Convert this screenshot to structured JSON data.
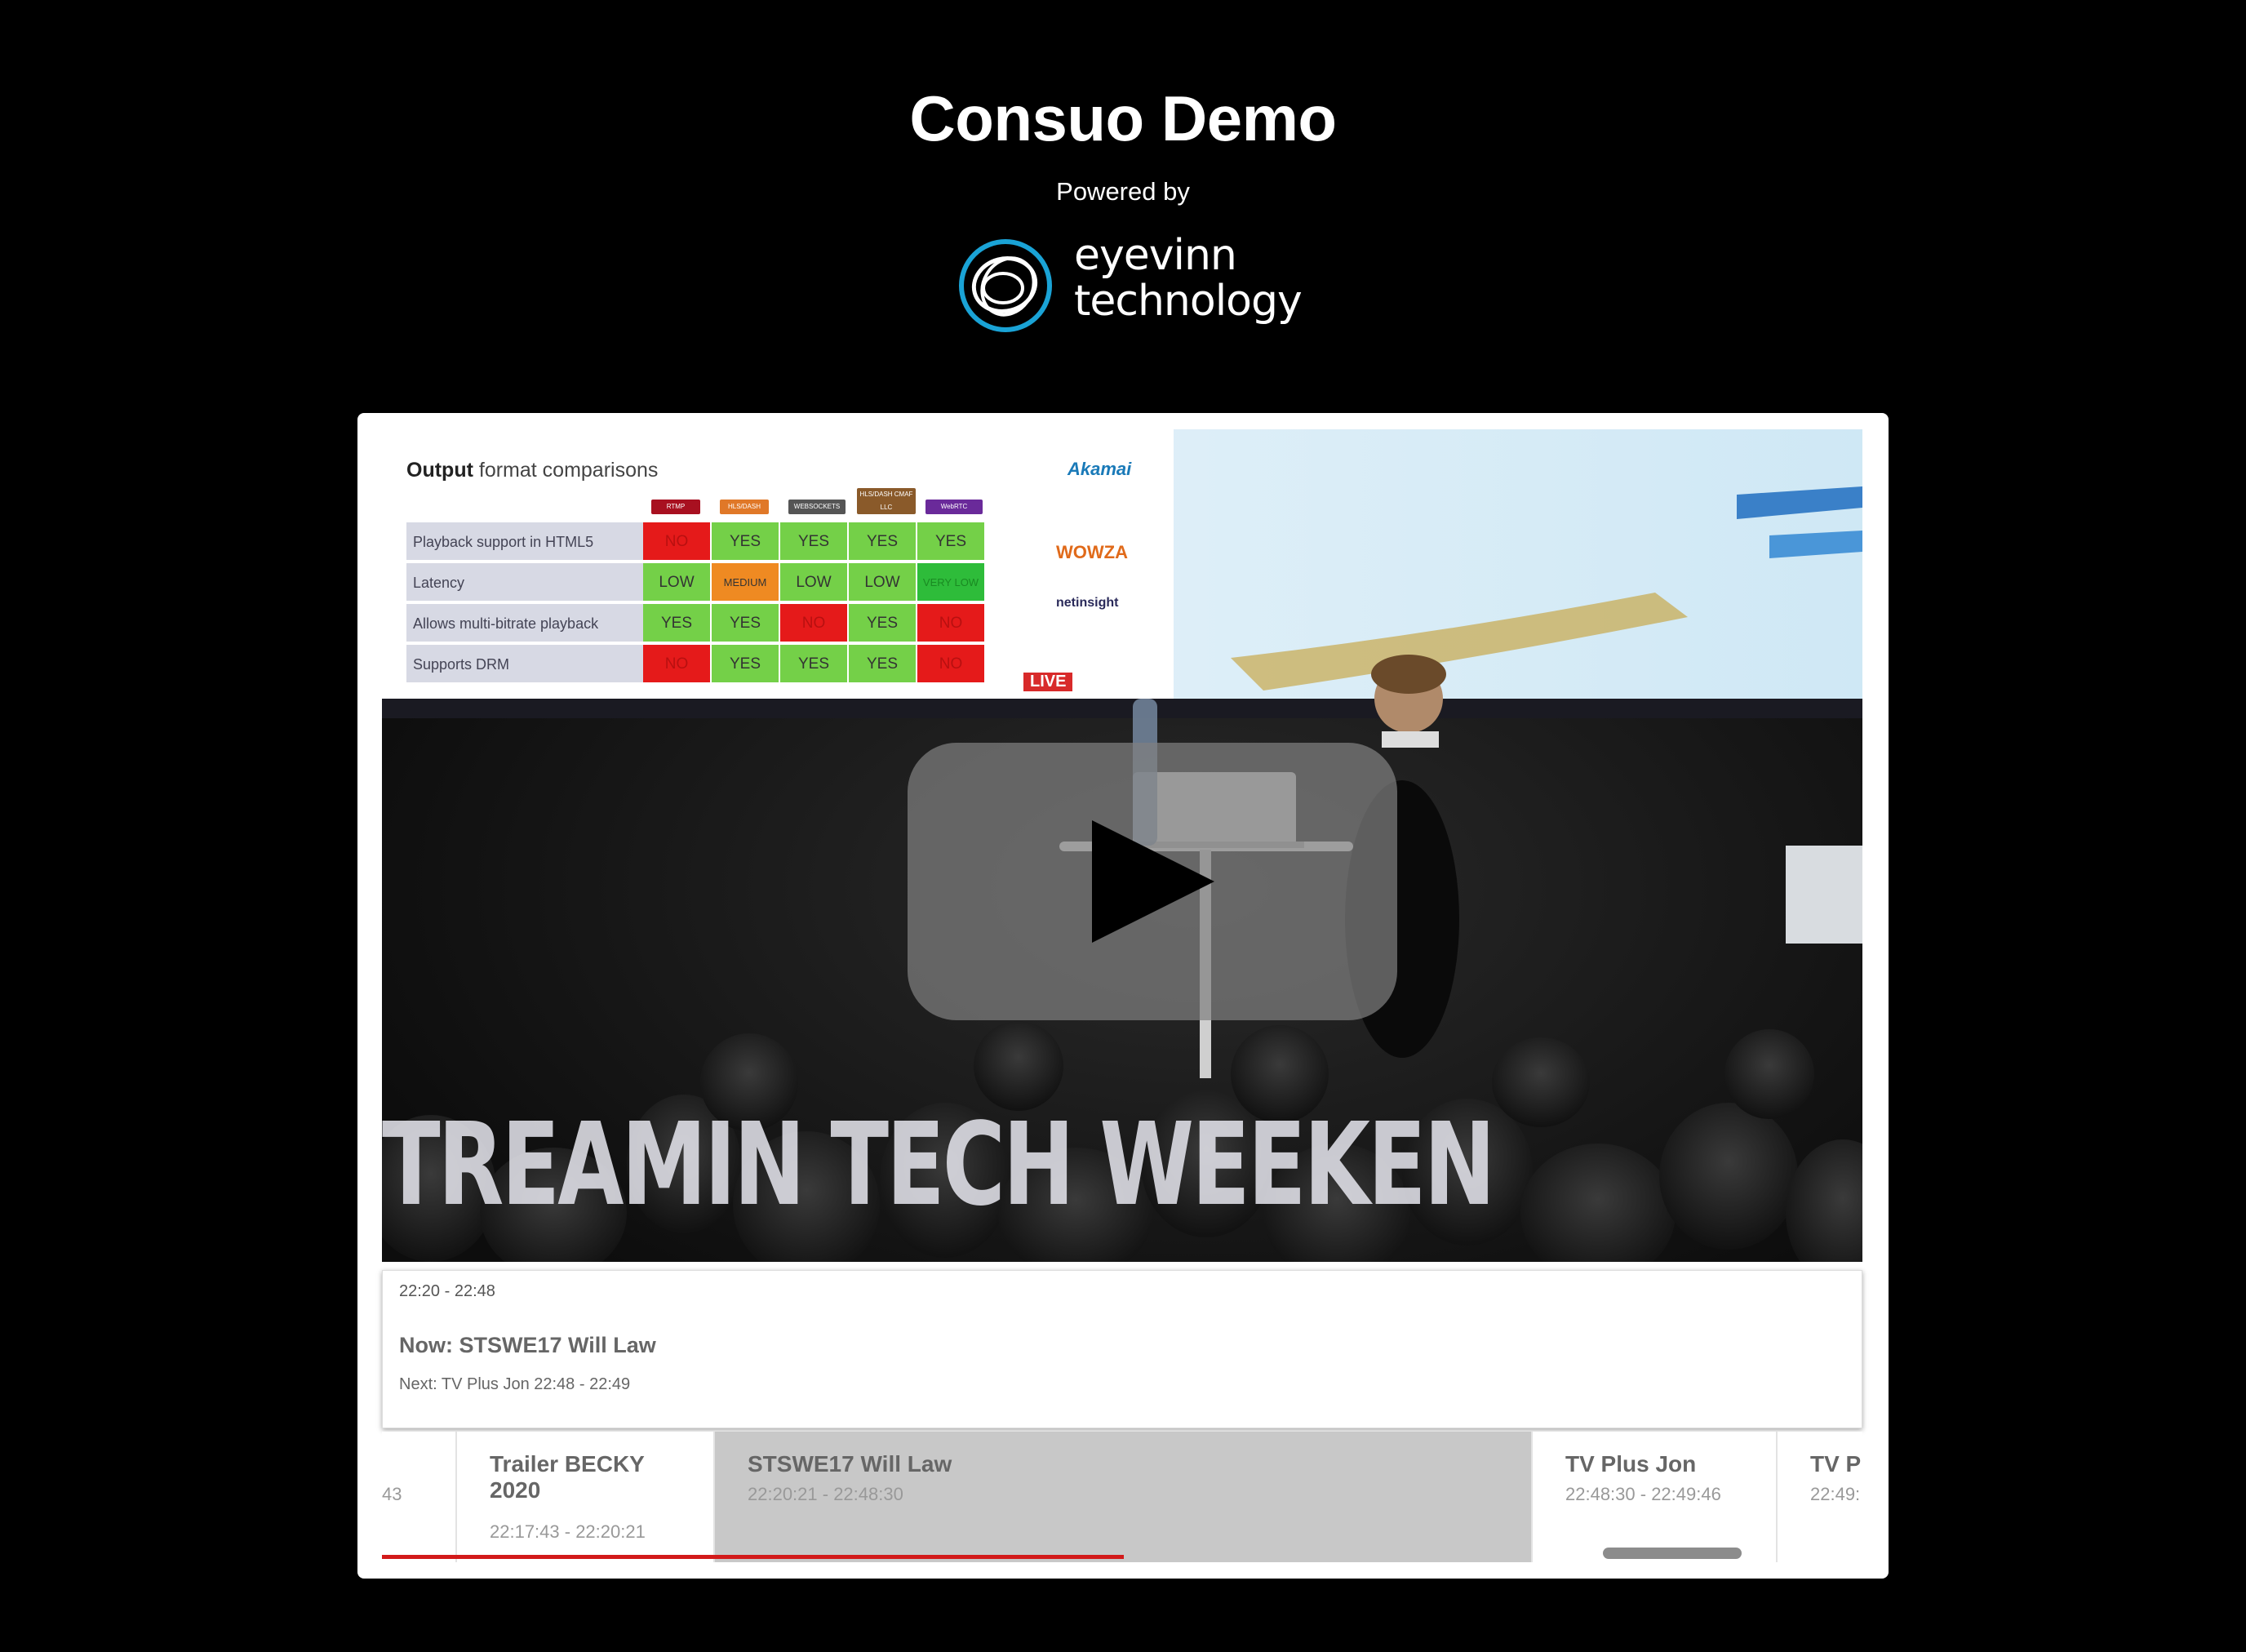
{
  "header": {
    "title": "Consuo Demo",
    "powered_by": "Powered by",
    "logo_line1": "eyevinn",
    "logo_line2": "technology"
  },
  "video": {
    "slide": {
      "title_bold": "Output",
      "title_rest": " format comparisons",
      "brand": "Akamai",
      "formats": [
        "RTMP",
        "HLS/DASH",
        "WEBSOCKETS",
        "HLS/DASH CMAF LLC",
        "WebRTC"
      ],
      "rows": [
        {
          "label": "Playback support in HTML5",
          "cells": [
            "NO",
            "YES",
            "YES",
            "YES",
            "YES"
          ]
        },
        {
          "label": "Latency",
          "cells": [
            "LOW",
            "MEDIUM",
            "LOW",
            "LOW",
            "VERY LOW"
          ]
        },
        {
          "label": "Allows multi-bitrate playback",
          "cells": [
            "YES",
            "YES",
            "NO",
            "YES",
            "NO"
          ]
        },
        {
          "label": "Supports DRM",
          "cells": [
            "NO",
            "YES",
            "YES",
            "YES",
            "NO"
          ]
        }
      ],
      "partners": [
        "WOWZA",
        "netinsight",
        "LIVE"
      ]
    },
    "stage_text": "TREAMIN TECH WEEKEN",
    "play_label": "play"
  },
  "now_panel": {
    "time": "22:20 - 22:48",
    "now": "Now: STSWE17 Will Law",
    "next": "Next: TV Plus Jon 22:48 - 22:49"
  },
  "timeline": [
    {
      "title": "",
      "time": "43",
      "progress": 1.0,
      "current": false
    },
    {
      "title": "Trailer BECKY 2020",
      "time": "22:17:43 - 22:20:21",
      "progress": 1.0,
      "current": false
    },
    {
      "title": "STSWE17 Will Law",
      "time": "22:20:21 - 22:48:30",
      "progress": 0.5,
      "current": true
    },
    {
      "title": "TV Plus Jon",
      "time": "22:48:30 - 22:49:46",
      "progress": 0,
      "current": false
    },
    {
      "title": "TV Pl",
      "time": "22:49:",
      "progress": 0,
      "current": false
    }
  ],
  "colors": {
    "background": "#000000",
    "accent_red": "#d21a1a",
    "logo_ring": "#1aa3d6",
    "current_program_bg": "#c8c8c8"
  }
}
